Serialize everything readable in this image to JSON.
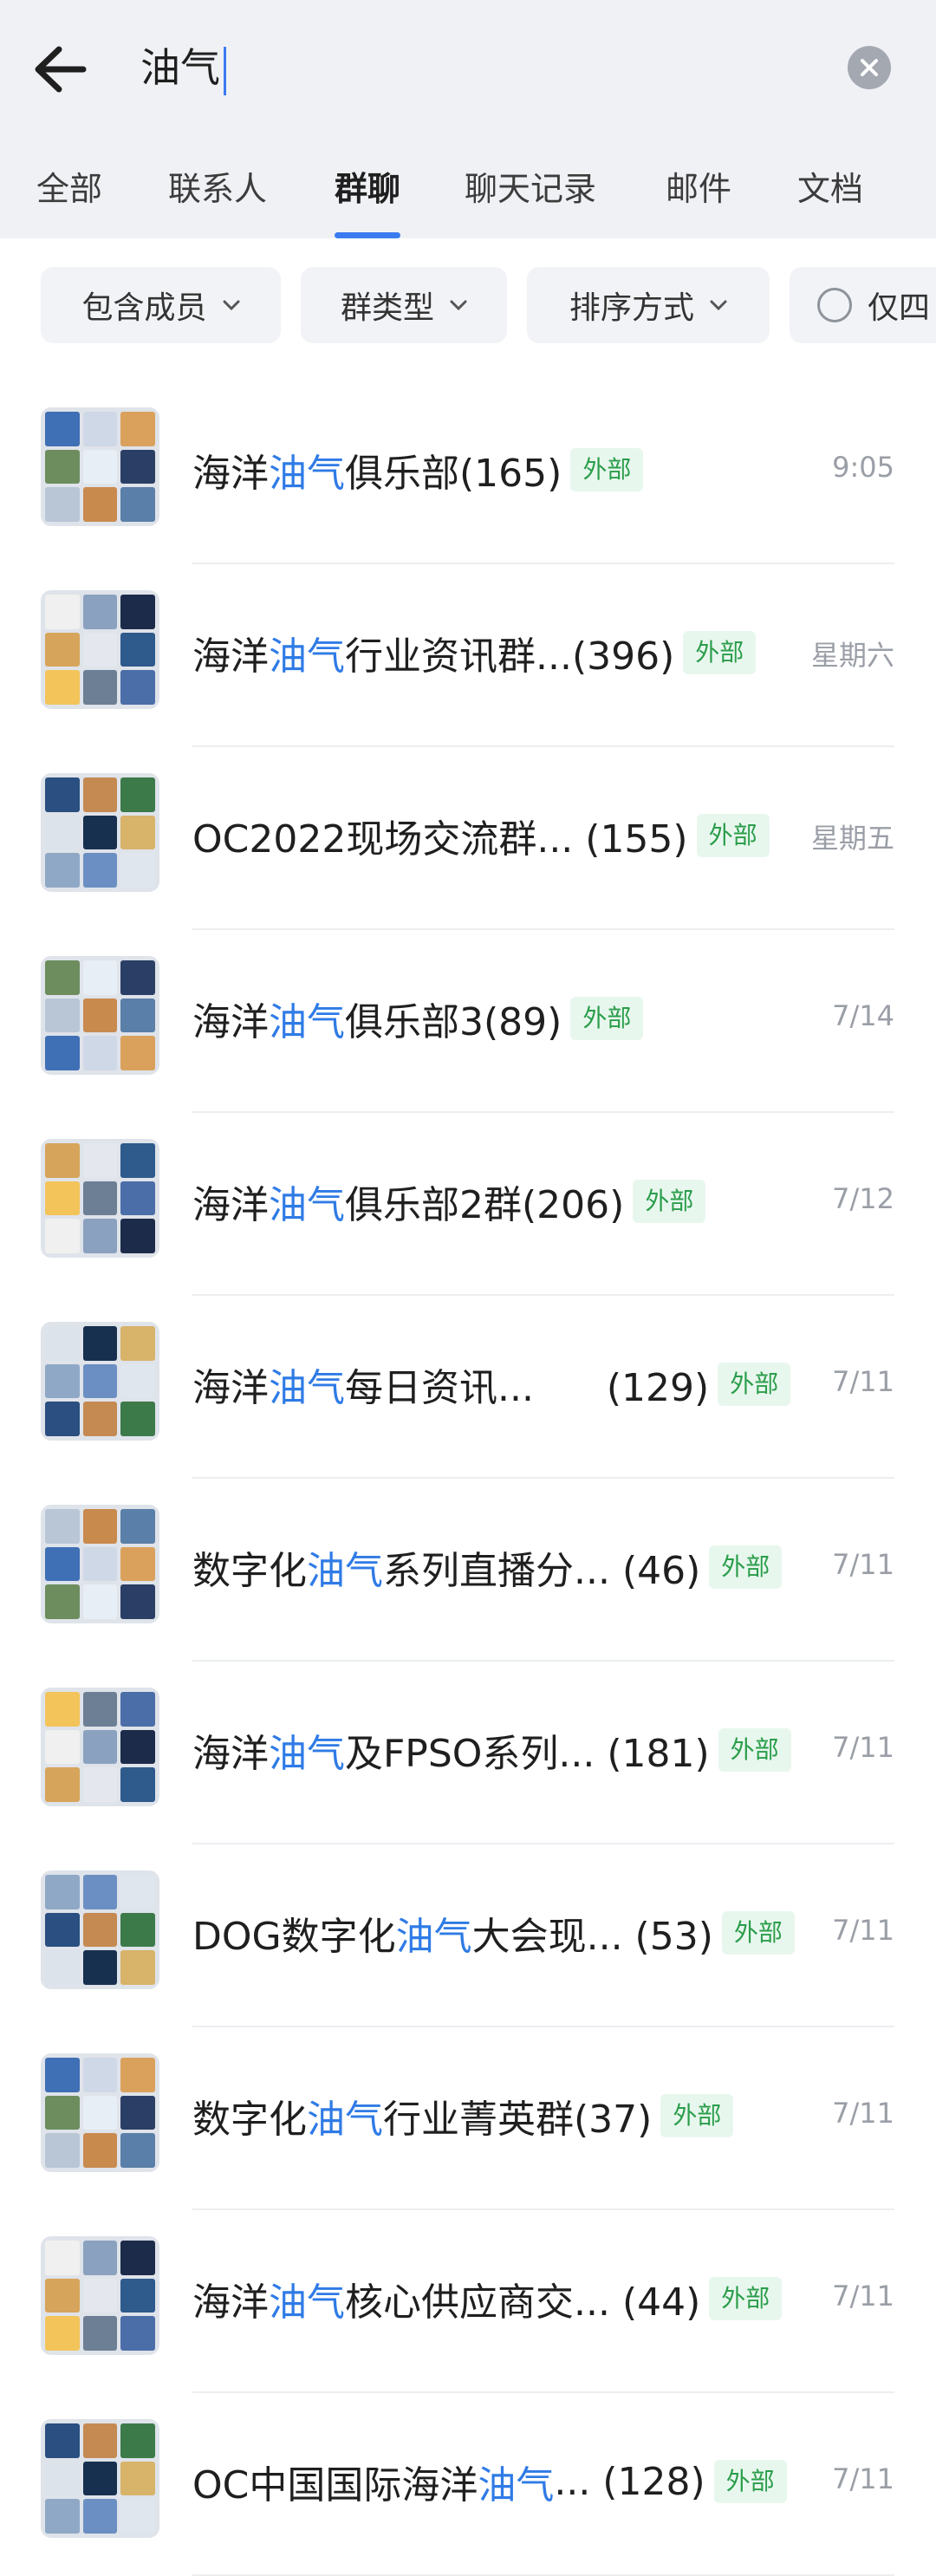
{
  "search": {
    "query": "油气"
  },
  "tabs": [
    "全部",
    "联系人",
    "群聊",
    "聊天记录",
    "邮件",
    "文档"
  ],
  "active_tab_index": 2,
  "filters": {
    "members": "包含成员",
    "group_type": "群类型",
    "sort": "排序方式",
    "only": "仅四"
  },
  "colors": {
    "accent": "#2f7be6",
    "badge_bg": "#e8f7ee",
    "badge_text": "#2a9d4a"
  },
  "groups": [
    {
      "pre": "海洋",
      "hl": "油气",
      "post": "俱乐部(165)",
      "badge": "外部",
      "time": "9:05"
    },
    {
      "pre": "海洋",
      "hl": "油气",
      "post": "行业资讯群...(396)",
      "badge": "外部",
      "time": "星期六"
    },
    {
      "pre": "OC2022现场交流群... (155)",
      "hl": "",
      "post": "",
      "badge": "外部",
      "time": "星期五"
    },
    {
      "pre": "海洋",
      "hl": "油气",
      "post": "俱乐部3(89)",
      "badge": "外部",
      "time": "7/14"
    },
    {
      "pre": "海洋",
      "hl": "油气",
      "post": "俱乐部2群(206)",
      "badge": "外部",
      "time": "7/12"
    },
    {
      "pre": "海洋",
      "hl": "油气",
      "post": "每日资讯...      (129)",
      "badge": "外部",
      "time": "7/11"
    },
    {
      "pre": "数字化",
      "hl": "油气",
      "post": "系列直播分... (46)",
      "badge": "外部",
      "time": "7/11"
    },
    {
      "pre": "海洋",
      "hl": "油气",
      "post": "及FPSO系列... (181)",
      "badge": "外部",
      "time": "7/11"
    },
    {
      "pre": "DOG数字化",
      "hl": "油气",
      "post": "大会现... (53)",
      "badge": "外部",
      "time": "7/11"
    },
    {
      "pre": "数字化",
      "hl": "油气",
      "post": "行业菁英群(37)",
      "badge": "外部",
      "time": "7/11"
    },
    {
      "pre": "海洋",
      "hl": "油气",
      "post": "核心供应商交... (44)",
      "badge": "外部",
      "time": "7/11"
    },
    {
      "pre": "OC中国国际海洋",
      "hl": "油气",
      "post": "... (128)",
      "badge": "外部",
      "time": "7/11"
    }
  ]
}
